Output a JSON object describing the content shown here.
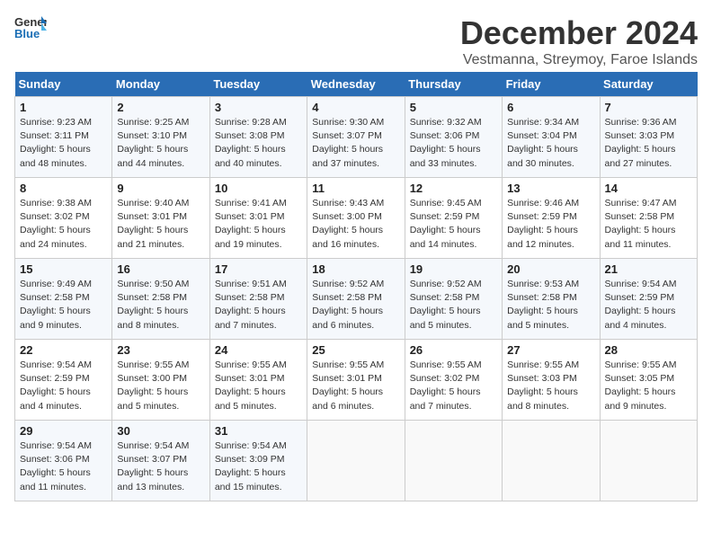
{
  "header": {
    "logo_line1": "General",
    "logo_line2": "Blue",
    "title": "December 2024",
    "subtitle": "Vestmanna, Streymoy, Faroe Islands"
  },
  "days_of_week": [
    "Sunday",
    "Monday",
    "Tuesday",
    "Wednesday",
    "Thursday",
    "Friday",
    "Saturday"
  ],
  "weeks": [
    [
      {
        "day": "1",
        "info": "Sunrise: 9:23 AM\nSunset: 3:11 PM\nDaylight: 5 hours\nand 48 minutes."
      },
      {
        "day": "2",
        "info": "Sunrise: 9:25 AM\nSunset: 3:10 PM\nDaylight: 5 hours\nand 44 minutes."
      },
      {
        "day": "3",
        "info": "Sunrise: 9:28 AM\nSunset: 3:08 PM\nDaylight: 5 hours\nand 40 minutes."
      },
      {
        "day": "4",
        "info": "Sunrise: 9:30 AM\nSunset: 3:07 PM\nDaylight: 5 hours\nand 37 minutes."
      },
      {
        "day": "5",
        "info": "Sunrise: 9:32 AM\nSunset: 3:06 PM\nDaylight: 5 hours\nand 33 minutes."
      },
      {
        "day": "6",
        "info": "Sunrise: 9:34 AM\nSunset: 3:04 PM\nDaylight: 5 hours\nand 30 minutes."
      },
      {
        "day": "7",
        "info": "Sunrise: 9:36 AM\nSunset: 3:03 PM\nDaylight: 5 hours\nand 27 minutes."
      }
    ],
    [
      {
        "day": "8",
        "info": "Sunrise: 9:38 AM\nSunset: 3:02 PM\nDaylight: 5 hours\nand 24 minutes."
      },
      {
        "day": "9",
        "info": "Sunrise: 9:40 AM\nSunset: 3:01 PM\nDaylight: 5 hours\nand 21 minutes."
      },
      {
        "day": "10",
        "info": "Sunrise: 9:41 AM\nSunset: 3:01 PM\nDaylight: 5 hours\nand 19 minutes."
      },
      {
        "day": "11",
        "info": "Sunrise: 9:43 AM\nSunset: 3:00 PM\nDaylight: 5 hours\nand 16 minutes."
      },
      {
        "day": "12",
        "info": "Sunrise: 9:45 AM\nSunset: 2:59 PM\nDaylight: 5 hours\nand 14 minutes."
      },
      {
        "day": "13",
        "info": "Sunrise: 9:46 AM\nSunset: 2:59 PM\nDaylight: 5 hours\nand 12 minutes."
      },
      {
        "day": "14",
        "info": "Sunrise: 9:47 AM\nSunset: 2:58 PM\nDaylight: 5 hours\nand 11 minutes."
      }
    ],
    [
      {
        "day": "15",
        "info": "Sunrise: 9:49 AM\nSunset: 2:58 PM\nDaylight: 5 hours\nand 9 minutes."
      },
      {
        "day": "16",
        "info": "Sunrise: 9:50 AM\nSunset: 2:58 PM\nDaylight: 5 hours\nand 8 minutes."
      },
      {
        "day": "17",
        "info": "Sunrise: 9:51 AM\nSunset: 2:58 PM\nDaylight: 5 hours\nand 7 minutes."
      },
      {
        "day": "18",
        "info": "Sunrise: 9:52 AM\nSunset: 2:58 PM\nDaylight: 5 hours\nand 6 minutes."
      },
      {
        "day": "19",
        "info": "Sunrise: 9:52 AM\nSunset: 2:58 PM\nDaylight: 5 hours\nand 5 minutes."
      },
      {
        "day": "20",
        "info": "Sunrise: 9:53 AM\nSunset: 2:58 PM\nDaylight: 5 hours\nand 5 minutes."
      },
      {
        "day": "21",
        "info": "Sunrise: 9:54 AM\nSunset: 2:59 PM\nDaylight: 5 hours\nand 4 minutes."
      }
    ],
    [
      {
        "day": "22",
        "info": "Sunrise: 9:54 AM\nSunset: 2:59 PM\nDaylight: 5 hours\nand 4 minutes."
      },
      {
        "day": "23",
        "info": "Sunrise: 9:55 AM\nSunset: 3:00 PM\nDaylight: 5 hours\nand 5 minutes."
      },
      {
        "day": "24",
        "info": "Sunrise: 9:55 AM\nSunset: 3:01 PM\nDaylight: 5 hours\nand 5 minutes."
      },
      {
        "day": "25",
        "info": "Sunrise: 9:55 AM\nSunset: 3:01 PM\nDaylight: 5 hours\nand 6 minutes."
      },
      {
        "day": "26",
        "info": "Sunrise: 9:55 AM\nSunset: 3:02 PM\nDaylight: 5 hours\nand 7 minutes."
      },
      {
        "day": "27",
        "info": "Sunrise: 9:55 AM\nSunset: 3:03 PM\nDaylight: 5 hours\nand 8 minutes."
      },
      {
        "day": "28",
        "info": "Sunrise: 9:55 AM\nSunset: 3:05 PM\nDaylight: 5 hours\nand 9 minutes."
      }
    ],
    [
      {
        "day": "29",
        "info": "Sunrise: 9:54 AM\nSunset: 3:06 PM\nDaylight: 5 hours\nand 11 minutes."
      },
      {
        "day": "30",
        "info": "Sunrise: 9:54 AM\nSunset: 3:07 PM\nDaylight: 5 hours\nand 13 minutes."
      },
      {
        "day": "31",
        "info": "Sunrise: 9:54 AM\nSunset: 3:09 PM\nDaylight: 5 hours\nand 15 minutes."
      },
      {
        "day": "",
        "info": ""
      },
      {
        "day": "",
        "info": ""
      },
      {
        "day": "",
        "info": ""
      },
      {
        "day": "",
        "info": ""
      }
    ]
  ]
}
